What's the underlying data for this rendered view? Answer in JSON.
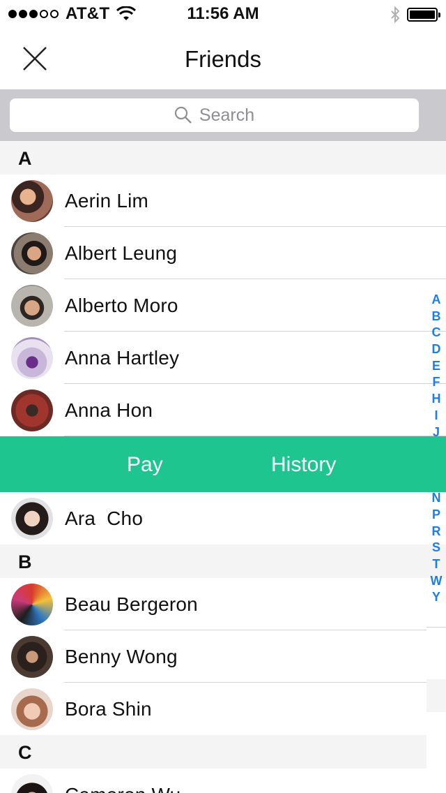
{
  "status_bar": {
    "carrier": "AT&T",
    "time": "11:56 AM",
    "signal_bars_filled": 3,
    "signal_bars_total": 5,
    "battery_level": 1.0
  },
  "nav": {
    "title": "Friends",
    "close_icon": "close-icon"
  },
  "search": {
    "placeholder": "Search"
  },
  "sections": [
    {
      "letter": "A",
      "friends": [
        "Aerin Lim",
        "Albert Leung",
        "Alberto Moro",
        "Anna Hartley",
        "Anna Hon",
        "Ara  Cho"
      ]
    },
    {
      "letter": "B",
      "friends": [
        "Beau Bergeron",
        "Benny Wong",
        "Bora Shin"
      ]
    },
    {
      "letter": "C",
      "friends": [
        "Cameron Wu"
      ]
    }
  ],
  "action_bar": {
    "pay_label": "Pay",
    "history_label": "History",
    "color": "#1fc58e"
  },
  "index_letters": [
    "A",
    "B",
    "C",
    "D",
    "E",
    "F",
    "H",
    "I",
    "J",
    "N",
    "P",
    "R",
    "S",
    "T",
    "W",
    "Y"
  ],
  "colors": {
    "accent": "#1fc58e",
    "index_link": "#1f7de6",
    "search_bar_bg": "#c9c9ce"
  }
}
